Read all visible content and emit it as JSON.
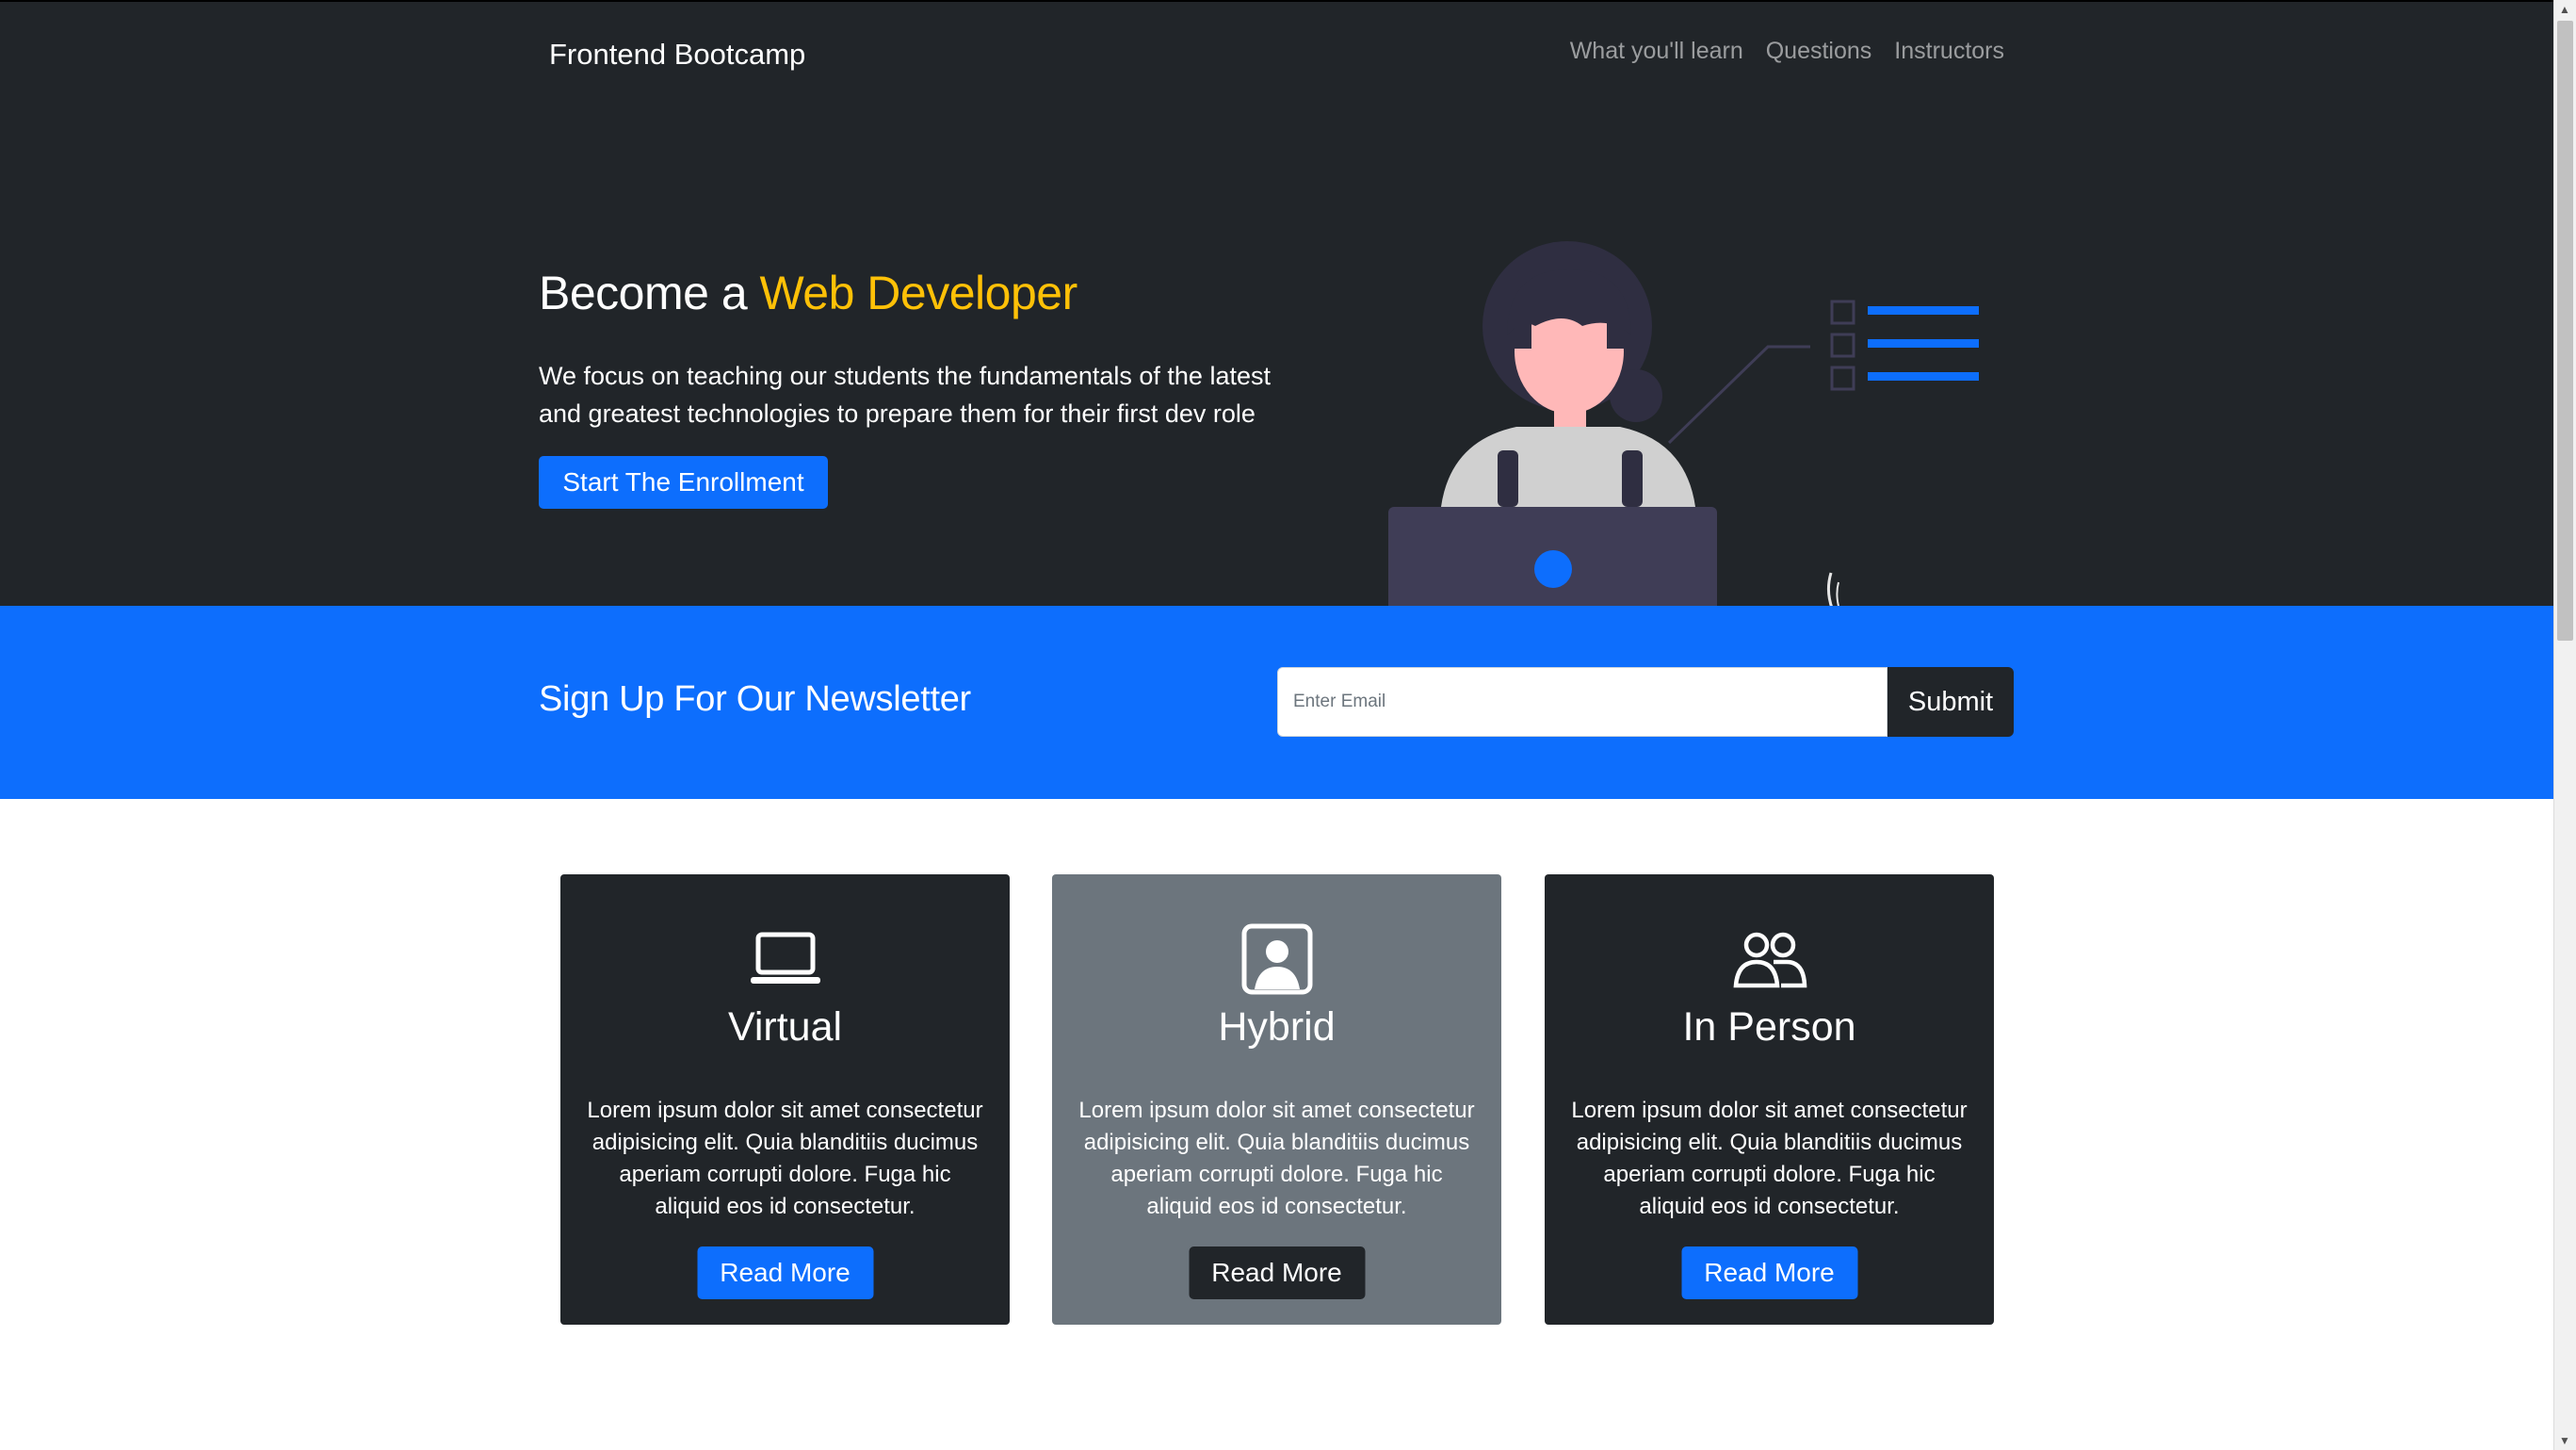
{
  "navbar": {
    "brand": "Frontend Bootcamp",
    "links": [
      "What you'll learn",
      "Questions",
      "Instructors"
    ]
  },
  "hero": {
    "title_prefix": "Become a ",
    "title_accent": "Web Developer",
    "lead": "We focus on teaching our students the fundamentals of the latest and greatest technologies to prepare them for their first dev role",
    "button_label": "Start The Enrollment"
  },
  "newsletter": {
    "title": "Sign Up For Our Newsletter",
    "email_placeholder": "Enter Email",
    "email_value": "",
    "submit_label": "Submit"
  },
  "cards": [
    {
      "icon": "laptop-icon",
      "title": "Virtual",
      "text": "Lorem ipsum dolor sit amet consectetur adipisicing elit. Quia blanditiis ducimus aperiam corrupti dolore. Fuga hic aliquid eos id consectetur.",
      "button_label": "Read More"
    },
    {
      "icon": "person-badge-icon",
      "title": "Hybrid",
      "text": "Lorem ipsum dolor sit amet consectetur adipisicing elit. Quia blanditiis ducimus aperiam corrupti dolore. Fuga hic aliquid eos id consectetur.",
      "button_label": "Read More"
    },
    {
      "icon": "people-icon",
      "title": "In Person",
      "text": "Lorem ipsum dolor sit amet consectetur adipisicing elit. Quia blanditiis ducimus aperiam corrupti dolore. Fuga hic aliquid eos id consectetur.",
      "button_label": "Read More"
    }
  ],
  "colors": {
    "dark": "#212529",
    "primary": "#0d6efd",
    "warning": "#ffc107",
    "secondary": "#6c757d"
  }
}
